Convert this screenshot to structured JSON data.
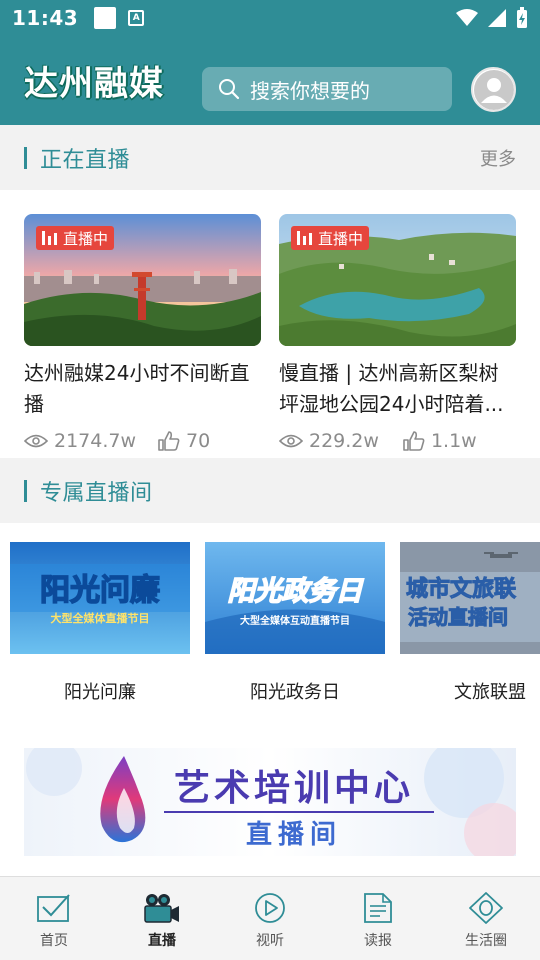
{
  "status": {
    "time": "11:43"
  },
  "header": {
    "brand": "达州融媒",
    "search_placeholder": "搜索你想要的"
  },
  "live_section": {
    "title": "正在直播",
    "more": "更多"
  },
  "live_cards": [
    {
      "badge": "直播中",
      "title": "达州融媒24小时不间断直播",
      "views": "2174.7w",
      "likes": "70"
    },
    {
      "badge": "直播中",
      "title": "慢直播 | 达州高新区梨树坪湿地公园24小时陪着...",
      "views": "229.2w",
      "likes": "1.1w"
    }
  ],
  "rooms_section": {
    "title": "专属直播间"
  },
  "rooms": [
    {
      "label": "阳光问廉",
      "art_title": "阳光问廉",
      "art_sub": "大型全媒体直播节目"
    },
    {
      "label": "阳光政务日",
      "art_title": "阳光政务日",
      "art_sub": "大型全媒体互动直播节目"
    },
    {
      "label": "文旅联盟",
      "art_title": "城市文旅联",
      "art_sub": "活动直播间"
    }
  ],
  "banner": {
    "line1": "艺术培训中心",
    "line2": "直播间"
  },
  "tabs": [
    {
      "label": "首页",
      "icon": "home-icon"
    },
    {
      "label": "直播",
      "icon": "live-camera-icon"
    },
    {
      "label": "视听",
      "icon": "play-icon"
    },
    {
      "label": "读报",
      "icon": "newspaper-icon"
    },
    {
      "label": "生活圈",
      "icon": "life-circle-icon"
    }
  ],
  "colors": {
    "accent": "#2f8d96",
    "live_badge": "#e6463d"
  }
}
